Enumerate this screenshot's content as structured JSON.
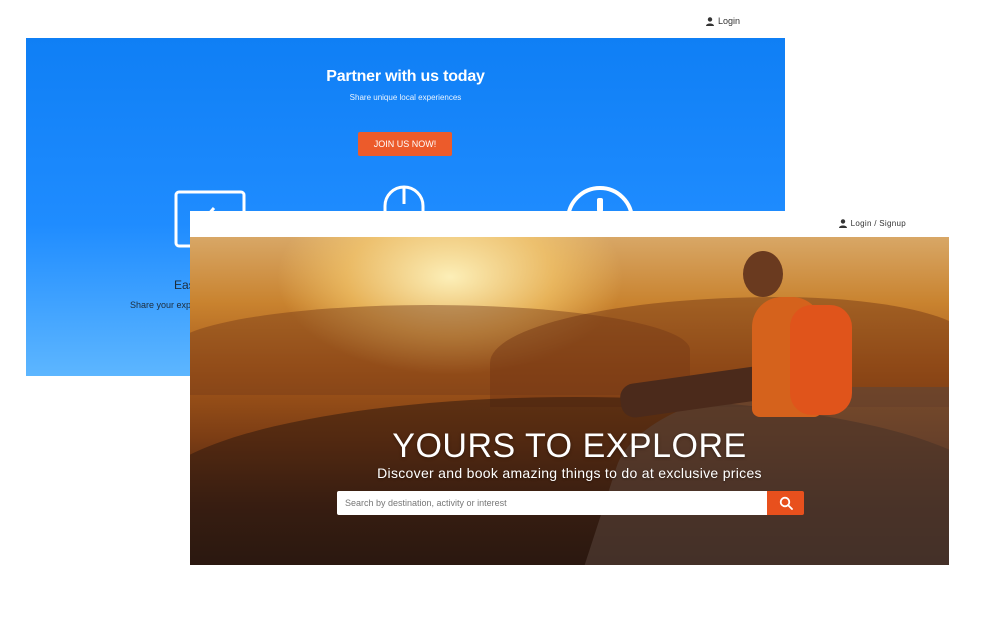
{
  "partner_page": {
    "login_label": "Login",
    "title": "Partner with us today",
    "subtitle": "Share unique local experiences",
    "join_button": "JOIN US NOW!",
    "feature_title_visible": "Eas",
    "feature_text_visible": "Share your exp",
    "colors": {
      "hero_blue": "#1f8cff",
      "button_orange": "#ec5b2b"
    }
  },
  "explore_page": {
    "login_label": "Login / Signup",
    "title": "YOURS TO EXPLORE",
    "subtitle": "Discover and book amazing things to do at exclusive prices",
    "search": {
      "placeholder": "Search by destination, activity or interest",
      "value": ""
    },
    "colors": {
      "search_button": "#e8501d"
    },
    "icons": [
      "user-icon",
      "search-icon"
    ]
  }
}
